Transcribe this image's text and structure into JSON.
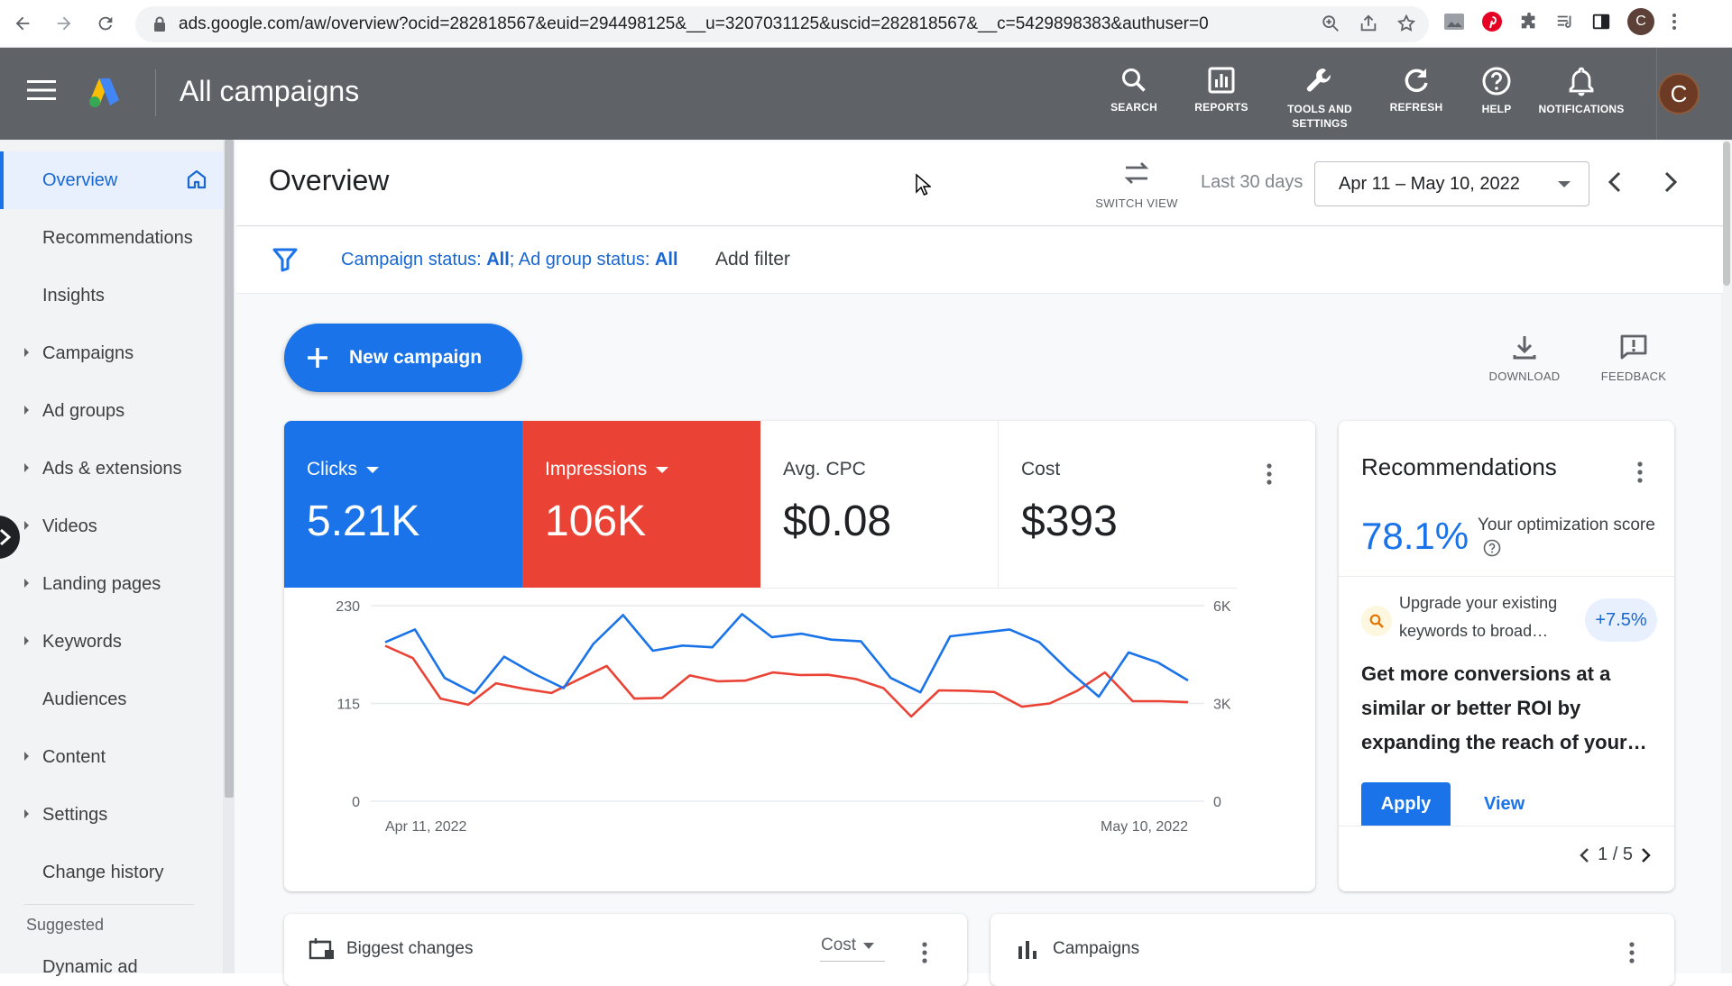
{
  "browser": {
    "url": "ads.google.com/aw/overview?ocid=282818567&euid=294498125&__u=3207031125&uscid=282818567&__c=5429898383&authuser=0",
    "profile_initial": "C"
  },
  "header": {
    "title": "All campaigns",
    "tools": [
      {
        "label": "SEARCH",
        "icon": "search-icon"
      },
      {
        "label": "REPORTS",
        "icon": "reports-icon"
      },
      {
        "label": "TOOLS AND SETTINGS",
        "icon": "wrench-icon"
      },
      {
        "label": "REFRESH",
        "icon": "refresh-icon"
      },
      {
        "label": "HELP",
        "icon": "help-icon"
      },
      {
        "label": "NOTIFICATIONS",
        "icon": "bell-icon"
      }
    ],
    "avatar_initial": "C"
  },
  "sidebar": {
    "items": [
      {
        "label": "Overview",
        "active": true,
        "expandable": false
      },
      {
        "label": "Recommendations",
        "expandable": false
      },
      {
        "label": "Insights",
        "expandable": false
      },
      {
        "label": "Campaigns",
        "expandable": true
      },
      {
        "label": "Ad groups",
        "expandable": true
      },
      {
        "label": "Ads & extensions",
        "expandable": true
      },
      {
        "label": "Videos",
        "expandable": true
      },
      {
        "label": "Landing pages",
        "expandable": true
      },
      {
        "label": "Keywords",
        "expandable": true
      },
      {
        "label": "Audiences",
        "expandable": false
      },
      {
        "label": "Content",
        "expandable": true
      },
      {
        "label": "Settings",
        "expandable": true
      },
      {
        "label": "Change history",
        "expandable": false
      }
    ],
    "suggested_label": "Suggested",
    "suggested_item": "Dynamic ad"
  },
  "overview": {
    "title": "Overview",
    "switch_view_label": "SWITCH VIEW",
    "range_label": "Last 30 days",
    "date_range": "Apr 11 – May 10, 2022"
  },
  "filter": {
    "campaign_status_prefix": "Campaign status: ",
    "campaign_status_value": "All",
    "ad_group_status_prefix": "; Ad group status: ",
    "ad_group_status_value": "All",
    "add_filter": "Add filter"
  },
  "actions": {
    "new_campaign": "New campaign",
    "download": "DOWNLOAD",
    "feedback": "FEEDBACK"
  },
  "metrics": {
    "clicks": {
      "label": "Clicks",
      "value": "5.21K",
      "color": "#1a73e8"
    },
    "impressions": {
      "label": "Impressions",
      "value": "106K",
      "color": "#ea4335"
    },
    "avg_cpc": {
      "label": "Avg. CPC",
      "value": "$0.08"
    },
    "cost": {
      "label": "Cost",
      "value": "$393"
    }
  },
  "chart_data": {
    "type": "line",
    "x": [
      "Apr 11, 2022",
      "Apr 12, 2022",
      "Apr 13, 2022",
      "Apr 14, 2022",
      "Apr 15, 2022",
      "Apr 16, 2022",
      "Apr 17, 2022",
      "Apr 18, 2022",
      "Apr 19, 2022",
      "Apr 20, 2022",
      "Apr 21, 2022",
      "Apr 22, 2022",
      "Apr 23, 2022",
      "Apr 24, 2022",
      "Apr 25, 2022",
      "Apr 26, 2022",
      "Apr 27, 2022",
      "Apr 28, 2022",
      "Apr 29, 2022",
      "Apr 30, 2022",
      "May 1, 2022",
      "May 2, 2022",
      "May 3, 2022",
      "May 4, 2022",
      "May 5, 2022",
      "May 6, 2022",
      "May 7, 2022",
      "May 8, 2022",
      "May 9, 2022",
      "May 10, 2022"
    ],
    "x_tick_labels": [
      "Apr 11, 2022",
      "May 10, 2022"
    ],
    "left_axis": {
      "ticks": [
        "230",
        "115",
        "0"
      ],
      "ylim": [
        0,
        230
      ]
    },
    "right_axis": {
      "ticks": [
        "6K",
        "3K",
        "0"
      ],
      "ylim": [
        0,
        6000
      ]
    },
    "series": [
      {
        "name": "Clicks",
        "axis": "left",
        "color": "#1a73e8",
        "values": [
          187,
          202,
          145,
          127,
          170,
          150,
          133,
          185,
          219,
          177,
          183,
          181,
          220,
          193,
          197,
          190,
          188,
          145,
          128,
          194,
          198,
          202,
          187,
          153,
          123,
          175,
          163,
          142
        ]
      },
      {
        "name": "Impressions",
        "axis": "right",
        "color": "#ea4335",
        "values": [
          4770,
          4390,
          3150,
          2960,
          3620,
          3450,
          3320,
          3740,
          4150,
          3150,
          3170,
          3860,
          3680,
          3700,
          3950,
          3870,
          3880,
          3750,
          3470,
          2600,
          3400,
          3390,
          3350,
          2900,
          3000,
          3390,
          3950,
          3070,
          3070,
          3040
        ]
      }
    ],
    "ylim_left": [
      0,
      230
    ],
    "ylim_right": [
      0,
      6000
    ],
    "grid": true
  },
  "recommendations": {
    "title": "Recommendations",
    "score": "78.1%",
    "score_label": "Your optimization score",
    "suggestion": "Upgrade your existing keywords to broad…",
    "uplift": "+7.5%",
    "body": "Get more conversions at a similar or better ROI by expanding the reach of your…",
    "apply": "Apply",
    "view": "View",
    "pager": "1 / 5"
  },
  "bottom_cards": {
    "biggest_changes": "Biggest changes",
    "cost_selector": "Cost",
    "campaigns": "Campaigns"
  }
}
